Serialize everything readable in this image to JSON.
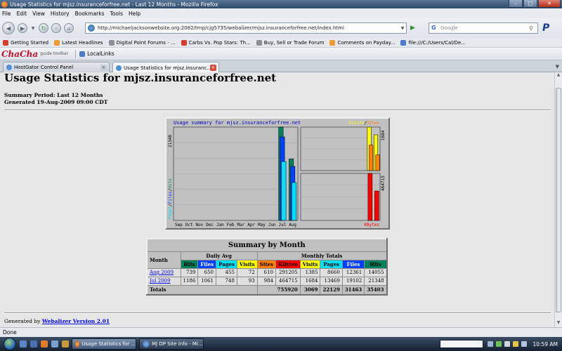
{
  "window": {
    "title": "Usage Statistics for mjsz.insuranceforfree.net - Last 12 Months - Mozilla Firefox"
  },
  "menu": [
    "File",
    "Edit",
    "View",
    "History",
    "Bookmarks",
    "Tools",
    "Help"
  ],
  "nav": {
    "url": "http://michaeljacksonwebsite.org:2082/tmp/cjg5735/webalizer/mjsz.insuranceforfree.net/index.html",
    "search_placeholder": "Google"
  },
  "bookmarks": [
    "Getting Started",
    "Latest Headlines",
    "Digital Point Forums - ...",
    "Carbs Vs. Pop Stars: Th...",
    "Buy, Sell or Trade Forum",
    "Comments on Payday...",
    "file:///C:/Users/Cal/De..."
  ],
  "toolbar": {
    "logo": "ChaCha",
    "sub": "guide toolbar",
    "local_links": "LocalLinks"
  },
  "tabs": [
    {
      "label": "HostGator Control Panel",
      "active": false
    },
    {
      "label": "Usage Statistics for mjsz.insuranc...",
      "active": true
    }
  ],
  "page": {
    "title": "Usage Statistics for mjsz.insuranceforfree.net",
    "period": "Summary Period: Last 12 Months",
    "generated": "Generated 19-Aug-2009 09:00 CDT",
    "footer_prefix": "Generated by ",
    "footer_link": "Webalizer Version 2.01"
  },
  "chart_data": {
    "type": "bar",
    "title": "Usage summary for mjsz.insuranceforfree.net",
    "categories": [
      "Sep",
      "Oct",
      "Nov",
      "Dec",
      "Jan",
      "Feb",
      "Mar",
      "Apr",
      "May",
      "Jun",
      "Jul",
      "Aug"
    ],
    "left_axis_max_label": "21348",
    "visits_axis_max_label": "1684",
    "kbytes_axis_max_label": "464715",
    "left_axis_label_parts": [
      "Pages",
      "/",
      "Files",
      "/",
      "Hits"
    ],
    "visits_legend_parts": [
      "Visits",
      "/",
      "Sites"
    ],
    "kbytes_legend": "KBytes",
    "series": [
      {
        "name": "Hits",
        "color": "#00805c",
        "values": [
          0,
          0,
          0,
          0,
          0,
          0,
          0,
          0,
          0,
          0,
          21348,
          14055
        ]
      },
      {
        "name": "Files",
        "color": "#0040ff",
        "values": [
          0,
          0,
          0,
          0,
          0,
          0,
          0,
          0,
          0,
          0,
          19102,
          12361
        ]
      },
      {
        "name": "Pages",
        "color": "#00e0ff",
        "values": [
          0,
          0,
          0,
          0,
          0,
          0,
          0,
          0,
          0,
          0,
          13469,
          8660
        ]
      },
      {
        "name": "Visits",
        "color": "#ffff00",
        "values": [
          0,
          0,
          0,
          0,
          0,
          0,
          0,
          0,
          0,
          0,
          1684,
          1385
        ]
      },
      {
        "name": "Sites",
        "color": "#ff8000",
        "values": [
          0,
          0,
          0,
          0,
          0,
          0,
          0,
          0,
          0,
          0,
          984,
          610
        ]
      },
      {
        "name": "KBytes",
        "color": "#ff0000",
        "values": [
          0,
          0,
          0,
          0,
          0,
          0,
          0,
          0,
          0,
          0,
          464715,
          291205
        ]
      }
    ]
  },
  "summary": {
    "caption": "Summary by Month",
    "col_month": "Month",
    "group_daily": "Daily Avg",
    "group_monthly": "Monthly Totals",
    "daily_headers": [
      "Hits",
      "Files",
      "Pages",
      "Visits"
    ],
    "monthly_headers": [
      "Sites",
      "KBytes",
      "Visits",
      "Pages",
      "Files",
      "Hits"
    ],
    "rows": [
      {
        "month": "Aug 2009",
        "values": [
          "739",
          "650",
          "455",
          "72",
          "610",
          "291205",
          "1385",
          "8660",
          "12361",
          "14055"
        ]
      },
      {
        "month": "Jul 2009",
        "values": [
          "1186",
          "1061",
          "748",
          "93",
          "984",
          "464715",
          "1684",
          "13469",
          "19102",
          "21348"
        ]
      }
    ],
    "totals_label": "Totals",
    "totals": [
      "755920",
      "3069",
      "22129",
      "31463",
      "35403"
    ]
  },
  "status": "Done",
  "taskbar": {
    "buttons": [
      "Usage Statistics for ...",
      "MJ DP Site info - Mi..."
    ],
    "clock": "10:59 AM"
  }
}
